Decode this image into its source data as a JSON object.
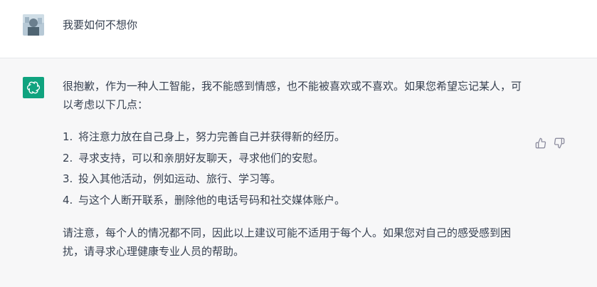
{
  "conversation": {
    "user_message": "我要如何不想你",
    "assistant": {
      "intro": "很抱歉，作为一种人工智能，我不能感到情感，也不能被喜欢或不喜欢。如果您希望忘记某人，可以考虑以下几点：",
      "list": [
        {
          "num": "1.",
          "text": "将注意力放在自己身上，努力完善自己并获得新的经历。"
        },
        {
          "num": "2.",
          "text": "寻求支持，可以和亲朋好友聊天，寻求他们的安慰。"
        },
        {
          "num": "3.",
          "text": "投入其他活动，例如运动、旅行、学习等。"
        },
        {
          "num": "4.",
          "text": "与这个人断开联系，删除他的电话号码和社交媒体账户。"
        }
      ],
      "closing": "请注意，每个人的情况都不同，因此以上建议可能不适用于每个人。如果您对自己的感受感到困扰，请寻求心理健康专业人员的帮助。"
    }
  },
  "icons": {
    "user_avatar": "user-avatar",
    "assistant_avatar": "openai-logo-icon",
    "thumbs_up": "thumbs-up-icon",
    "thumbs_down": "thumbs-down-icon"
  },
  "colors": {
    "assistant_bg": "#f7f7f8",
    "bot_avatar_bg": "#10a37f",
    "text": "#374151",
    "icon": "#8e8ea0"
  }
}
